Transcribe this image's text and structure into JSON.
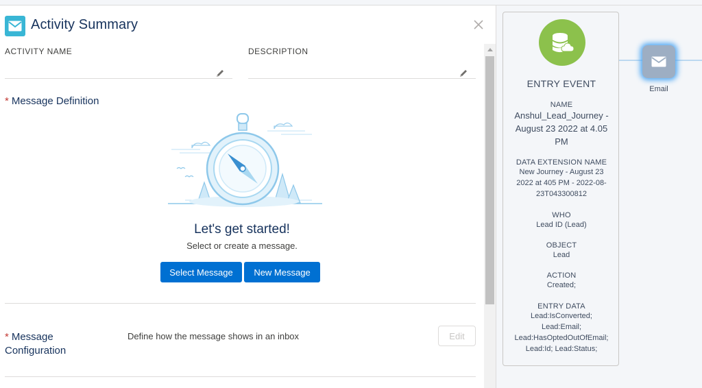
{
  "panel": {
    "title": "Activity Summary",
    "activity_name_label": "ACTIVITY NAME",
    "description_label": "DESCRIPTION",
    "message_definition_label": "Message Definition",
    "required_mark": "*",
    "started_title": "Let's get started!",
    "started_subtitle": "Select or create a message.",
    "select_message_label": "Select Message",
    "new_message_label": "New Message",
    "message_configuration_label_1": "Message",
    "message_configuration_label_2": "Configuration",
    "configuration_description": "Define how the message shows in an inbox",
    "edit_label": "Edit"
  },
  "entry_event": {
    "title": "ENTRY EVENT",
    "name_label": "NAME",
    "name_value_1": "Anshul_Lead_Journey -",
    "name_value_2": "August 23 2022 at 4.05",
    "name_value_3": "PM",
    "de_label": "DATA EXTENSION NAME",
    "de_value_1": "New Journey - August 23",
    "de_value_2": "2022 at 405 PM - 2022-08-",
    "de_value_3": "23T043300812",
    "who_label": "WHO",
    "who_value": "Lead ID (Lead)",
    "object_label": "OBJECT",
    "object_value": "Lead",
    "action_label": "ACTION",
    "action_value": "Created;",
    "entry_data_label": "ENTRY DATA",
    "entry_data_1": "Lead:IsConverted;",
    "entry_data_2": "Lead:Email;",
    "entry_data_3": "Lead:HasOptedOutOfEmail;",
    "entry_data_4": "Lead:Id; Lead:Status;"
  },
  "canvas": {
    "email_label": "Email"
  },
  "colors": {
    "brand_blue": "#0070d2",
    "entry_green": "#8cc14c",
    "header_icon": "#39b6d5",
    "required_red": "#c23934"
  },
  "icons": [
    "email-icon",
    "close-icon",
    "pencil-icon",
    "database-icon",
    "compass-illustration"
  ]
}
